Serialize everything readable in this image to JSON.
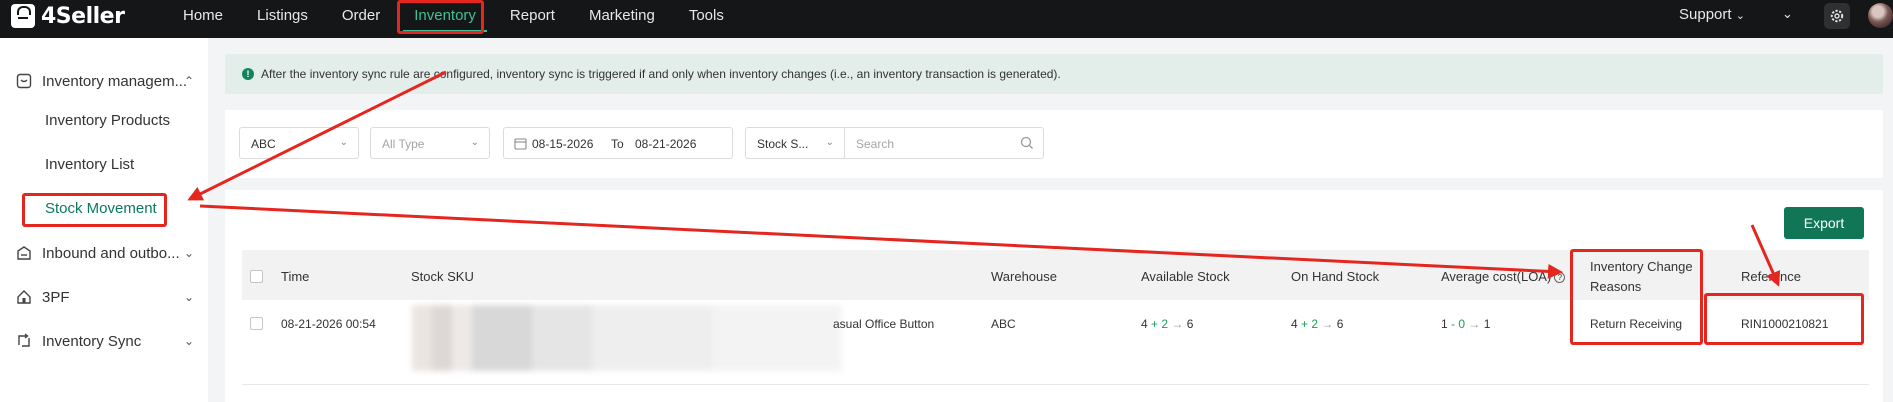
{
  "app": {
    "name": "4Seller"
  },
  "nav": {
    "items": [
      "Home",
      "Listings",
      "Order",
      "Inventory",
      "Report",
      "Marketing",
      "Tools"
    ],
    "active": "Inventory",
    "support_label": "Support"
  },
  "icons": {
    "gear": "gear-icon",
    "chevron": "chevron-down-icon",
    "info": "info-icon",
    "calendar": "calendar-icon",
    "search": "search-icon",
    "help": "question-icon"
  },
  "sidebar": {
    "groups": [
      {
        "label": "Inventory managem...",
        "icon": "inventory-icon",
        "expanded": true
      },
      {
        "label": "Inbound and outbo...",
        "icon": "inbound-icon",
        "expanded": false
      },
      {
        "label": "3PF",
        "icon": "home-icon",
        "expanded": false
      },
      {
        "label": "Inventory Sync",
        "icon": "sync-icon",
        "expanded": false
      }
    ],
    "items": [
      "Inventory Products",
      "Inventory List",
      "Stock Movement"
    ],
    "active_item": "Stock Movement"
  },
  "banner": {
    "text": "After the inventory sync rule are configured, inventory sync is triggered if and only when inventory changes (i.e., an inventory transaction is generated)."
  },
  "filters": {
    "warehouse": "ABC",
    "type_placeholder": "All Type",
    "date_from": "08-15-2026",
    "date_to_label": "To",
    "date_to": "08-21-2026",
    "search_field": "Stock S...",
    "search_placeholder": "Search"
  },
  "toolbar": {
    "export_label": "Export"
  },
  "table": {
    "columns": [
      "Time",
      "Stock SKU",
      "Warehouse",
      "Available Stock",
      "On Hand Stock",
      "Average cost(LOA)",
      "Inventory Change",
      "Reasons",
      "Reference"
    ],
    "rows": [
      {
        "time": "08-21-2026 00:54",
        "sku_fragment": "asual Office Button",
        "warehouse": "ABC",
        "available_from": "4",
        "available_delta": "+ 2",
        "available_to": "6",
        "onhand_from": "4",
        "onhand_delta": "+ 2",
        "onhand_to": "6",
        "cost_from": "1",
        "cost_delta": "- 0",
        "cost_to": "1",
        "reason": "Return Receiving",
        "reference": "RIN1000210821"
      }
    ]
  },
  "colors": {
    "accent": "#107656",
    "topbar": "#151617",
    "annotation": "#e5261f",
    "banner_bg": "#e3ede9"
  }
}
